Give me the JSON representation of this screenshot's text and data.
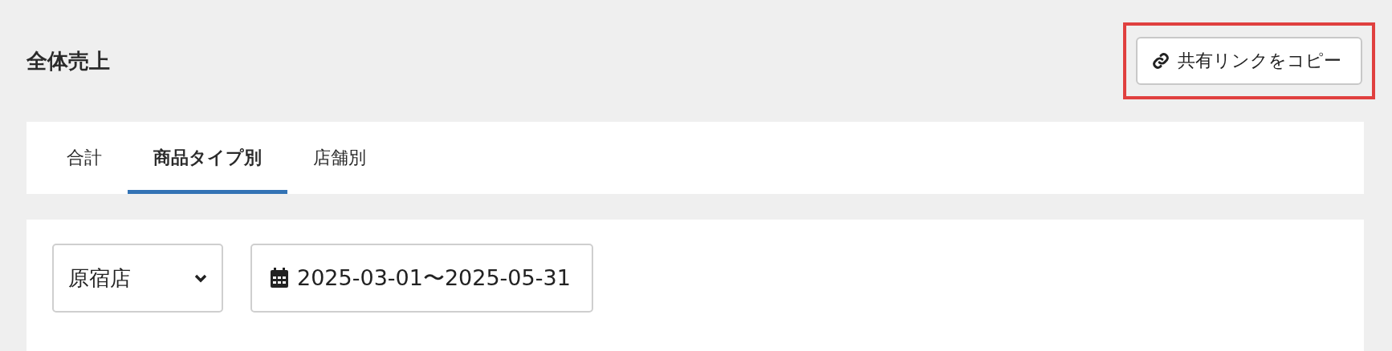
{
  "page": {
    "title": "全体売上"
  },
  "share_button": {
    "label": "共有リンクをコピー",
    "highlighted": true
  },
  "tabs": [
    {
      "label": "合計",
      "selected": false
    },
    {
      "label": "商品タイプ別",
      "selected": true
    },
    {
      "label": "店舗別",
      "selected": false
    }
  ],
  "filters": {
    "store": {
      "value": "原宿店"
    },
    "date_range": {
      "value": "2025-03-01〜2025-05-31"
    }
  }
}
